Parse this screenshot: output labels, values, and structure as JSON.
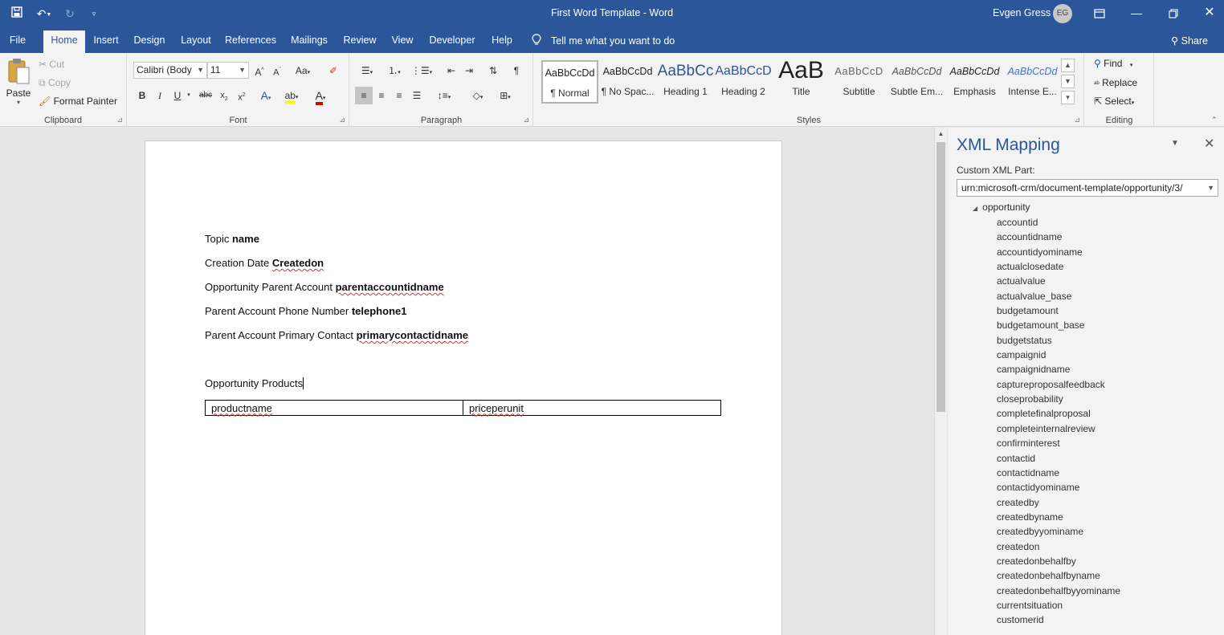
{
  "titlebar": {
    "document_title": "First Word Template  -  Word",
    "user_name": "Evgen Gress",
    "user_initials": "EG",
    "icons": [
      "save-icon",
      "undo-icon",
      "redo-icon",
      "customize-quick-access-icon",
      "ribbon-display-options-icon",
      "minimize-icon",
      "restore-icon",
      "close-icon"
    ]
  },
  "tabs": {
    "file": "File",
    "home": "Home",
    "insert": "Insert",
    "design": "Design",
    "layout": "Layout",
    "references": "References",
    "mailings": "Mailings",
    "review": "Review",
    "view": "View",
    "developer": "Developer",
    "help": "Help",
    "tell_me": "Tell me what you want to do",
    "share": "Share",
    "active": "Home"
  },
  "ribbon": {
    "clipboard": {
      "label": "Clipboard",
      "paste": "Paste",
      "cut": "Cut",
      "copy": "Copy",
      "format_painter": "Format Painter"
    },
    "font": {
      "label": "Font",
      "font_name": "Calibri (Body",
      "font_size": "11",
      "change_case": "Aa"
    },
    "paragraph": {
      "label": "Paragraph"
    },
    "styles": {
      "label": "Styles",
      "items": [
        {
          "preview": "AaBbCcDd",
          "name": "¶ Normal"
        },
        {
          "preview": "AaBbCcDd",
          "name": "¶ No Spac..."
        },
        {
          "preview": "AaBbCc",
          "name": "Heading 1"
        },
        {
          "preview": "AaBbCcD",
          "name": "Heading 2"
        },
        {
          "preview": "AaB",
          "name": "Title"
        },
        {
          "preview": "AaBbCcD",
          "name": "Subtitle"
        },
        {
          "preview": "AaBbCcDd",
          "name": "Subtle Em..."
        },
        {
          "preview": "AaBbCcDd",
          "name": "Emphasis"
        },
        {
          "preview": "AaBbCcDd",
          "name": "Intense E..."
        }
      ]
    },
    "editing": {
      "label": "Editing",
      "find": "Find",
      "replace": "Replace",
      "select": "Select"
    }
  },
  "document": {
    "lines": [
      {
        "label": "Topic ",
        "field": "name"
      },
      {
        "label": "Creation Date ",
        "field": "Createdon"
      },
      {
        "label": "Opportunity Parent Account ",
        "field": "parentaccountidname"
      },
      {
        "label": "Parent Account Phone Number ",
        "field": "telephone1"
      },
      {
        "label": "Parent Account Primary Contact ",
        "field": "primarycontactidname"
      }
    ],
    "products_heading": "Opportunity Products",
    "table": {
      "col1": "productname",
      "col2": "priceperunit"
    }
  },
  "xml_mapping": {
    "title": "XML Mapping",
    "custom_part_label": "Custom XML Part:",
    "custom_part_value": "urn:microsoft-crm/document-template/opportunity/3/",
    "root_node": "opportunity",
    "nodes": [
      "accountid",
      "accountidname",
      "accountidyominame",
      "actualclosedate",
      "actualvalue",
      "actualvalue_base",
      "budgetamount",
      "budgetamount_base",
      "budgetstatus",
      "campaignid",
      "campaignidname",
      "captureproposalfeedback",
      "closeprobability",
      "completefinalproposal",
      "completeinternalreview",
      "confirminterest",
      "contactid",
      "contactidname",
      "contactidyominame",
      "createdby",
      "createdbyname",
      "createdbyyominame",
      "createdon",
      "createdonbehalfby",
      "createdonbehalfbyname",
      "createdonbehalfbyyominame",
      "currentsituation",
      "customerid"
    ]
  },
  "colors": {
    "brand": "#2b579a",
    "ribbon": "#f3f3f3",
    "canvas": "#e6e6e6",
    "spelling": "#e03030"
  }
}
